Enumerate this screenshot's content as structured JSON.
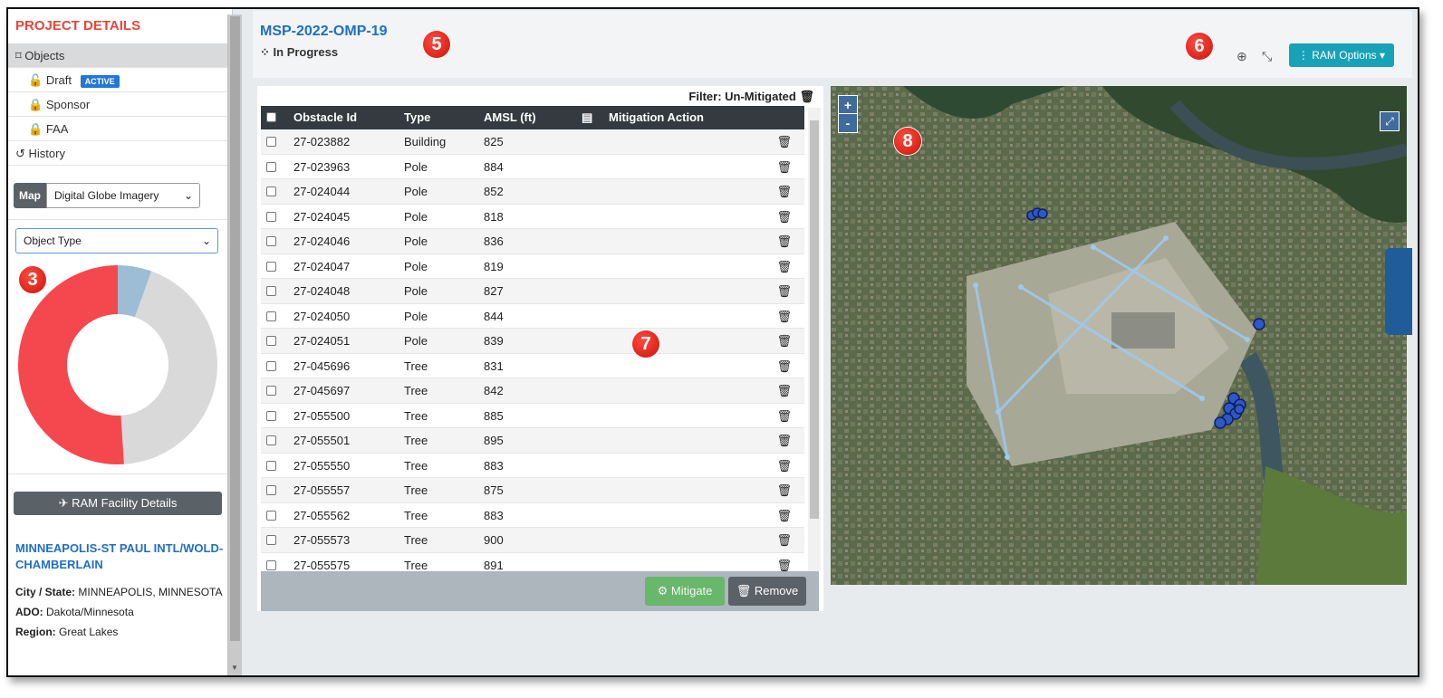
{
  "sidebar": {
    "title": "PROJECT DETAILS",
    "objects_label": "Objects",
    "items": [
      {
        "label": "Draft",
        "badge": "ACTIVE",
        "icon": "unlock-icon"
      },
      {
        "label": "Sponsor",
        "icon": "lock-icon"
      },
      {
        "label": "FAA",
        "icon": "lock-icon"
      }
    ],
    "history_label": "History",
    "map_label": "Map",
    "map_select": "Digital Globe Imagery",
    "type_select": "Object Type",
    "ram_facility_button": "RAM Facility Details",
    "facility": {
      "name": "MINNEAPOLIS-ST PAUL INTL/WOLD-CHAMBERLAIN",
      "city_label": "City / State:",
      "city_value": "MINNEAPOLIS, MINNESOTA",
      "ado_label": "ADO:",
      "ado_value": "Dakota/Minnesota",
      "region_label": "Region:",
      "region_value": "Great Lakes"
    }
  },
  "header": {
    "project_id": "MSP-2022-OMP-19",
    "status": "In Progress",
    "ram_options": "RAM Options"
  },
  "callouts": {
    "c3": "3",
    "c5": "5",
    "c6": "6",
    "c7": "7",
    "c8": "8"
  },
  "table": {
    "filter_label": "Filter: Un-Mitigated",
    "columns": [
      "Obstacle Id",
      "Type",
      "AMSL (ft)",
      "Mitigation Action"
    ],
    "rows": [
      [
        "27-023882",
        "Building",
        "825"
      ],
      [
        "27-023963",
        "Pole",
        "884"
      ],
      [
        "27-024044",
        "Pole",
        "852"
      ],
      [
        "27-024045",
        "Pole",
        "818"
      ],
      [
        "27-024046",
        "Pole",
        "836"
      ],
      [
        "27-024047",
        "Pole",
        "819"
      ],
      [
        "27-024048",
        "Pole",
        "827"
      ],
      [
        "27-024050",
        "Pole",
        "844"
      ],
      [
        "27-024051",
        "Pole",
        "839"
      ],
      [
        "27-045696",
        "Tree",
        "831"
      ],
      [
        "27-045697",
        "Tree",
        "842"
      ],
      [
        "27-055500",
        "Tree",
        "885"
      ],
      [
        "27-055501",
        "Tree",
        "895"
      ],
      [
        "27-055550",
        "Tree",
        "883"
      ],
      [
        "27-055557",
        "Tree",
        "875"
      ],
      [
        "27-055562",
        "Tree",
        "883"
      ],
      [
        "27-055573",
        "Tree",
        "900"
      ],
      [
        "27-055575",
        "Tree",
        "891"
      ]
    ],
    "mitigate_button": "Mitigate",
    "remove_button": "Remove"
  },
  "donut": {
    "segments": [
      {
        "fraction": 0.055,
        "color": "#9dbdd4"
      },
      {
        "fraction": 0.435,
        "color": "#d9d9d9"
      },
      {
        "fraction": 0.51,
        "color": "#f5484e"
      }
    ]
  },
  "map": {
    "zoom_in": "+",
    "zoom_out": "-"
  }
}
